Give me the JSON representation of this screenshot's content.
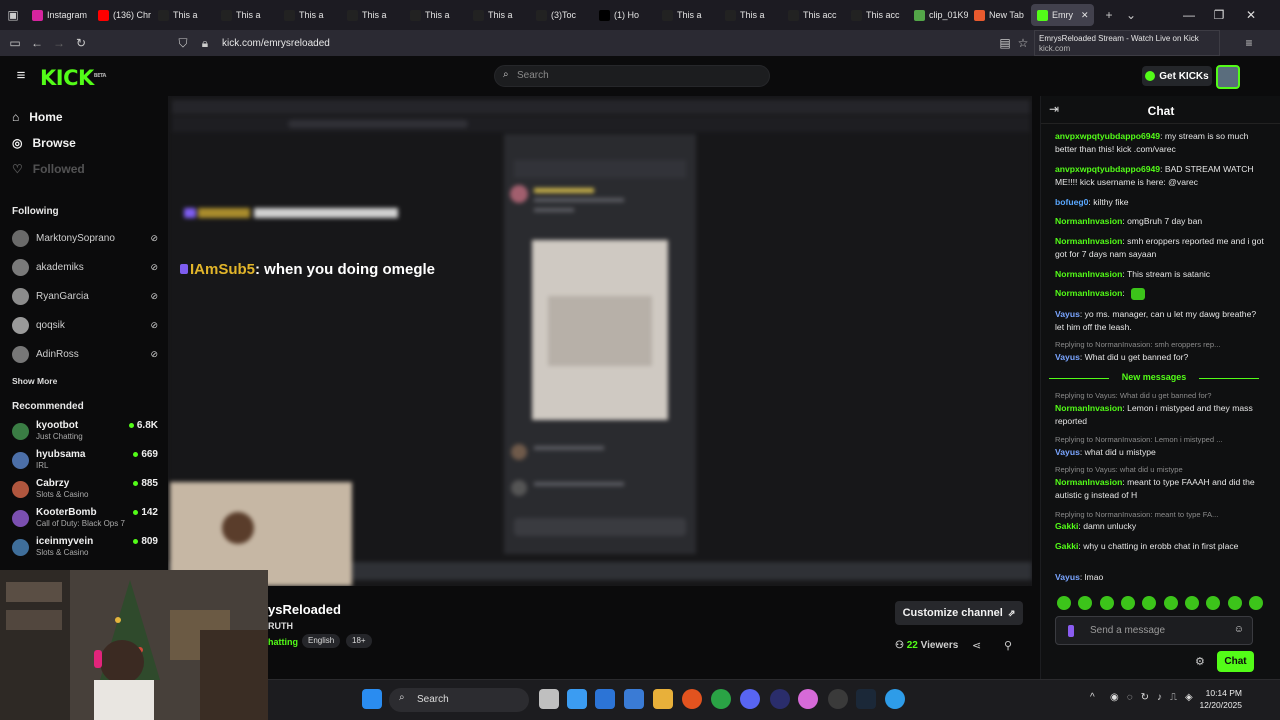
{
  "browser": {
    "tabs": [
      {
        "label": "Instagram",
        "favicon_color": "#d6249f"
      },
      {
        "label": "(136) Chr",
        "favicon_color": "#ff0000"
      },
      {
        "label": "This a",
        "favicon_color": "#222222"
      },
      {
        "label": "This a",
        "favicon_color": "#222222"
      },
      {
        "label": "This a",
        "favicon_color": "#222222"
      },
      {
        "label": "This a",
        "favicon_color": "#222222"
      },
      {
        "label": "This a",
        "favicon_color": "#222222"
      },
      {
        "label": "This a",
        "favicon_color": "#222222"
      },
      {
        "label": "(3)Toc",
        "favicon_color": "#222222"
      },
      {
        "label": "(1) Ho",
        "favicon_color": "#000000"
      },
      {
        "label": "This a",
        "favicon_color": "#222222"
      },
      {
        "label": "This a",
        "favicon_color": "#222222"
      },
      {
        "label": "This acc",
        "favicon_color": "#222222"
      },
      {
        "label": "This acc",
        "favicon_color": "#222222"
      },
      {
        "label": "clip_01K9",
        "favicon_color": "#53a548"
      },
      {
        "label": "New Tab",
        "favicon_color": "#e95a2e"
      },
      {
        "label": "Emry",
        "favicon_color": "#53fc18",
        "active": true
      }
    ],
    "url": "kick.com/emrysreloaded",
    "tooltip": {
      "title": "EmrysReloaded Stream - Watch Live on Kick",
      "domain": "kick.com"
    }
  },
  "header": {
    "logo": "KICK",
    "logo_sup": "BETA",
    "search_placeholder": "Search",
    "get_kicks": "Get KICKs"
  },
  "sidebar": {
    "nav": [
      "Home",
      "Browse",
      "Followed"
    ],
    "following_label": "Following",
    "following": [
      "MarktonySoprano",
      "akademiks",
      "RyanGarcia",
      "qoqsik",
      "AdinRoss"
    ],
    "show_more": "Show More",
    "recommended_label": "Recommended",
    "recommended": [
      {
        "name": "kyootbot",
        "category": "Just Chatting",
        "viewers": "6.8K"
      },
      {
        "name": "hyubsama",
        "category": "IRL",
        "viewers": "669"
      },
      {
        "name": "Cabrzy",
        "category": "Slots & Casino",
        "viewers": "885"
      },
      {
        "name": "KooterBomb",
        "category": "Call of Duty: Black Ops 7",
        "viewers": "142"
      },
      {
        "name": "iceinmyvein",
        "category": "Slots & Casino",
        "viewers": "809"
      }
    ]
  },
  "stream": {
    "overlay_user": "IAmSub5",
    "overlay_text": ": when you doing omegle",
    "channel_name": "ysReloaded",
    "title": "RUTH",
    "category": "hatting",
    "tags": [
      "English",
      "18+"
    ],
    "customize_label": "Customize channel",
    "viewer_count": "22",
    "viewer_label": " Viewers"
  },
  "chat": {
    "title": "Chat",
    "messages": [
      {
        "user": "anvpxwpqtyubdappo6949",
        "color": "#53fc18",
        "text": ": my stream is so much better than this! kick .com/varec"
      },
      {
        "user": "anvpxwpqtyubdappo6949",
        "color": "#53fc18",
        "text": ": BAD STREAM WATCH ME!!!! kick username is here: @varec"
      },
      {
        "user": "bofueg0",
        "color": "#5aa8ff",
        "text": ": kilthy fike"
      },
      {
        "user": "NormanInvasion",
        "color": "#53fc18",
        "text": ": omgBruh 7 day ban"
      },
      {
        "user": "NormanInvasion",
        "color": "#53fc18",
        "text": ": smh eroppers reported me and i got got for 7 days nam sayaan"
      },
      {
        "user": "NormanInvasion",
        "color": "#53fc18",
        "text": ": This stream is satanic"
      },
      {
        "user": "NormanInvasion",
        "color": "#53fc18",
        "text": ":"
      },
      {
        "user": "Vayus",
        "color": "#7aa5ff",
        "text": ": yo ms. manager, can u let my dawg breathe? let him off the leash."
      },
      {
        "user": "Vayus",
        "color": "#7aa5ff",
        "text": ": What did u get banned for?"
      },
      {
        "user": "NormanInvasion",
        "color": "#53fc18",
        "text": ": Lemon i mistyped and they mass reported"
      },
      {
        "user": "Vayus",
        "color": "#7aa5ff",
        "text": ": what did u mistype"
      },
      {
        "user": "NormanInvasion",
        "color": "#53fc18",
        "text": ": meant to type FAAAH and did the autistic g instead of H"
      },
      {
        "user": "Gakki",
        "color": "#53fc18",
        "text": ": damn unlucky"
      },
      {
        "user": "Gakki",
        "color": "#53fc18",
        "text": ": why u chatting in erobb chat in first place"
      },
      {
        "user": "Vayus",
        "color": "#7aa5ff",
        "text": ": lmao"
      }
    ],
    "replies": [
      "Replying to NormanInvasion: smh eroppers rep...",
      "Replying to Vayus: What did u get banned for?",
      "Replying to NormanInvasion: Lemon i mistyped ...",
      "Replying to Vayus: what did u mistype",
      "Replying to NormanInvasion: meant to type FA..."
    ],
    "new_messages": "New messages",
    "input_placeholder": "Send a message",
    "send_label": "Chat"
  },
  "taskbar": {
    "search": "Search",
    "time": "10:14 PM",
    "date": "12/20/2025"
  },
  "colors": {
    "kick_green": "#53fc18",
    "bg": "#0b0b0c"
  }
}
